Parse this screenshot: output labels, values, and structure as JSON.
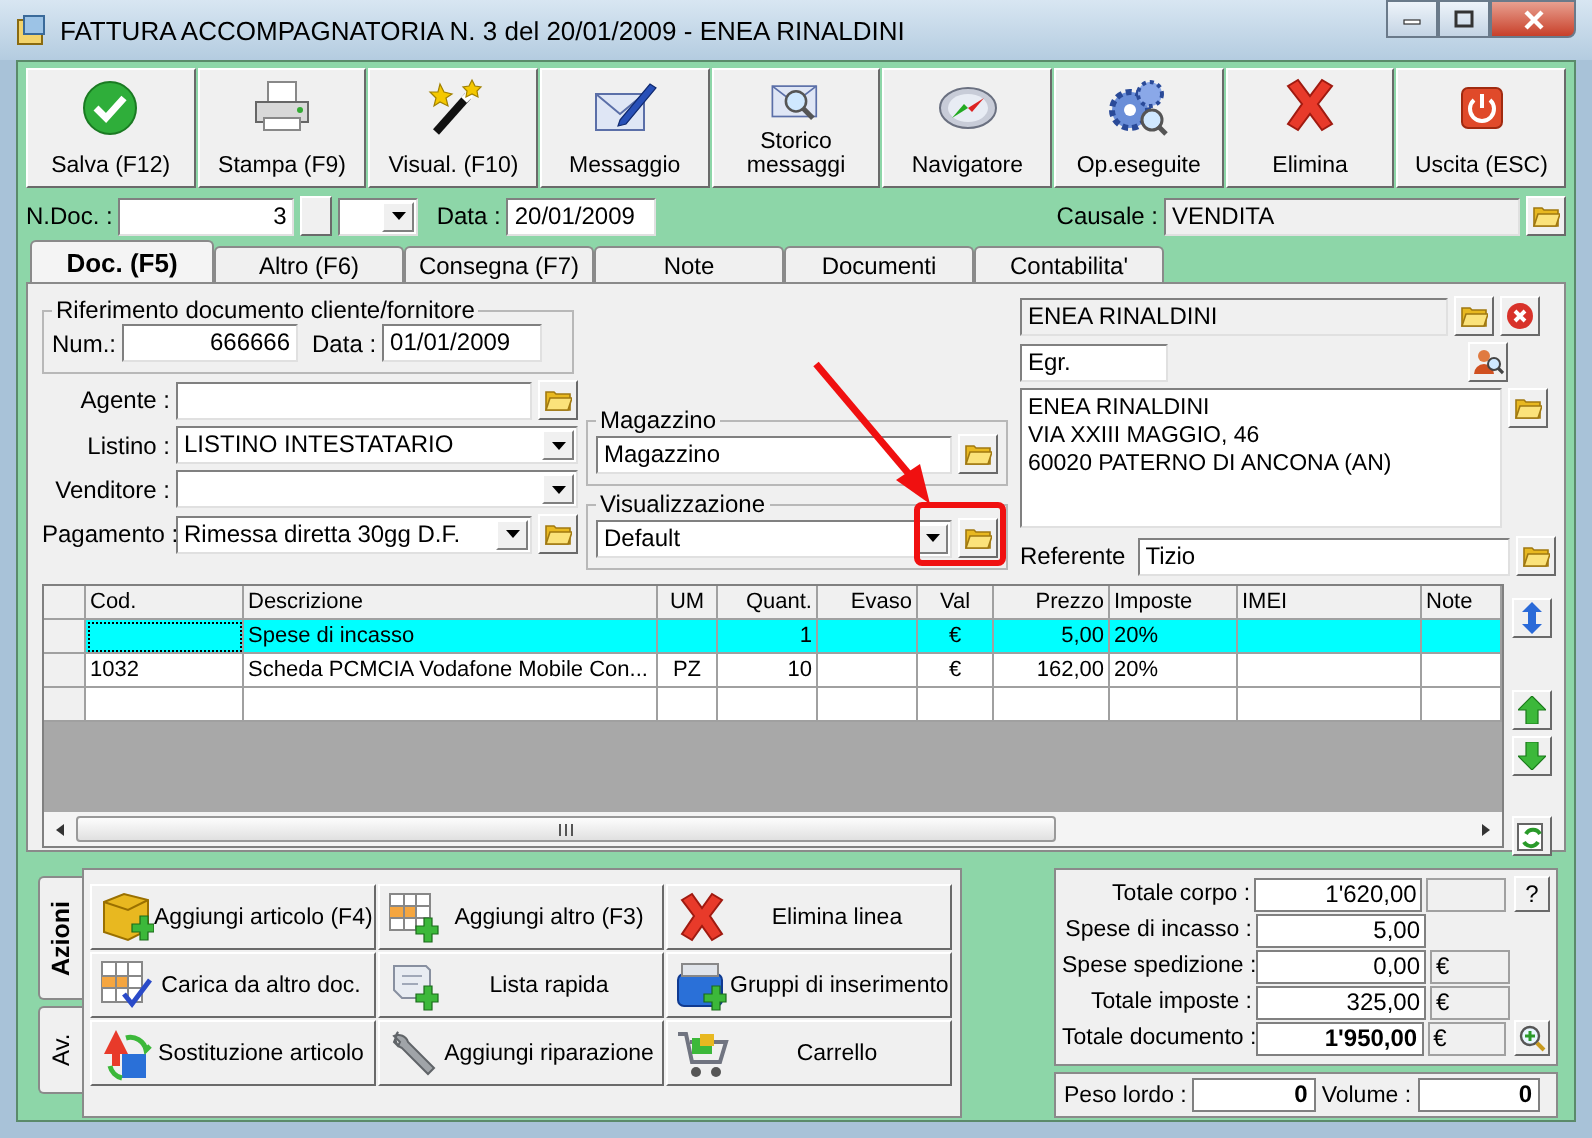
{
  "window": {
    "title": "FATTURA ACCOMPAGNATORIA N. 3  del 20/01/2009 - ENEA RINALDINI"
  },
  "toolbar": [
    {
      "label": "Salva (F12)",
      "kind": "save"
    },
    {
      "label": "Stampa (F9)",
      "kind": "print"
    },
    {
      "label": "Visual. (F10)",
      "kind": "wand"
    },
    {
      "label": "Messaggio",
      "kind": "message"
    },
    {
      "label": "Storico messaggi",
      "kind": "history"
    },
    {
      "label": "Navigatore",
      "kind": "compass"
    },
    {
      "label": "Op.eseguite",
      "kind": "gears"
    },
    {
      "label": "Elimina",
      "kind": "delete"
    },
    {
      "label": "Uscita (ESC)",
      "kind": "exit"
    }
  ],
  "header": {
    "ndoc_label": "N.Doc. :",
    "ndoc": "3",
    "data_label": "Data :",
    "data": "20/01/2009",
    "causale_label": "Causale :",
    "causale": "VENDITA"
  },
  "tabs": [
    {
      "label": "Doc. (F5)",
      "selected": true
    },
    {
      "label": "Altro (F6)",
      "selected": false
    },
    {
      "label": "Consegna (F7)",
      "selected": false
    },
    {
      "label": "Note",
      "selected": false
    },
    {
      "label": "Documenti",
      "selected": false
    },
    {
      "label": "Contabilita'",
      "selected": false
    }
  ],
  "reference": {
    "legend": "Riferimento documento cliente/fornitore",
    "num_label": "Num.:",
    "num": "666666",
    "data_label": "Data :",
    "data": "01/01/2009"
  },
  "fields": [
    {
      "label": "Agente :",
      "kind": "lookup"
    },
    {
      "label": "Listino :",
      "value": "LISTINO INTESTATARIO",
      "kind": "combo"
    },
    {
      "label": "Venditore :",
      "kind": "combo"
    },
    {
      "label": "Pagamento :",
      "value": "Rimessa diretta 30gg D.F.",
      "kind": "combo_lookup"
    }
  ],
  "groups": [
    {
      "legend": "Magazzino",
      "value": "Magazzino",
      "kind": "lookup"
    },
    {
      "legend": "Visualizzazione",
      "value": "Default",
      "kind": "combo_lookup"
    }
  ],
  "customer": {
    "name": "ENEA RINALDINI",
    "title": "Egr.",
    "address": [
      "ENEA RINALDINI",
      "VIA XXIII MAGGIO, 46",
      "60020 PATERNO DI ANCONA (AN)"
    ],
    "referente_label": "Referente",
    "referente": "Tizio"
  },
  "table": {
    "columns": [
      "Cod.",
      "Descrizione",
      "UM",
      "Quant.",
      "Evaso",
      "Val",
      "Prezzo",
      "Imposte",
      "IMEI",
      "Note"
    ],
    "rows": [
      {
        "selected": true,
        "cells": [
          null,
          "Spese di incasso",
          null,
          "1",
          null,
          "€",
          "5,00",
          "20%",
          null,
          null
        ]
      },
      {
        "selected": false,
        "cells": [
          "1032",
          "Scheda PCMCIA Vodafone Mobile Con...",
          "PZ",
          "10",
          null,
          "€",
          "162,00",
          "20%",
          null,
          null
        ]
      }
    ]
  },
  "side_tabs": [
    {
      "label": "Azioni",
      "selected": true
    },
    {
      "label": "Av.",
      "selected": false
    }
  ],
  "actions": [
    {
      "label": "Aggiungi articolo (F4)",
      "kind": "box_add"
    },
    {
      "label": "Aggiungi altro (F3)",
      "kind": "grid_add"
    },
    {
      "label": "Elimina linea",
      "kind": "delete"
    },
    {
      "label": "Carica da altro doc.",
      "kind": "grid_check"
    },
    {
      "label": "Lista rapida",
      "kind": "scroll_add"
    },
    {
      "label": "Gruppi di inserimento",
      "kind": "blue_add"
    },
    {
      "label": "Sostituzione articolo",
      "kind": "swap"
    },
    {
      "label": "Aggiungi riparazione",
      "kind": "wrench"
    },
    {
      "label": "Carrello",
      "kind": "cart"
    }
  ],
  "totals": [
    {
      "label": "Totale corpo :",
      "value": "1'620,00",
      "kind": "help",
      "button": "?"
    },
    {
      "label": "Spese di incasso :",
      "value": "5,00",
      "kind": "plain"
    },
    {
      "label": "Spese spedizione :",
      "value": "0,00",
      "kind": "currency",
      "unit": "€"
    },
    {
      "label": "Totale imposte :",
      "value": "325,00",
      "kind": "currency",
      "unit": "€"
    },
    {
      "label": "Totale documento :",
      "value": "1'950,00",
      "kind": "total",
      "unit": "€"
    }
  ],
  "weights": [
    {
      "label": "Peso lordo :",
      "value": "0"
    },
    {
      "label": "Volume :",
      "value": "0"
    }
  ]
}
